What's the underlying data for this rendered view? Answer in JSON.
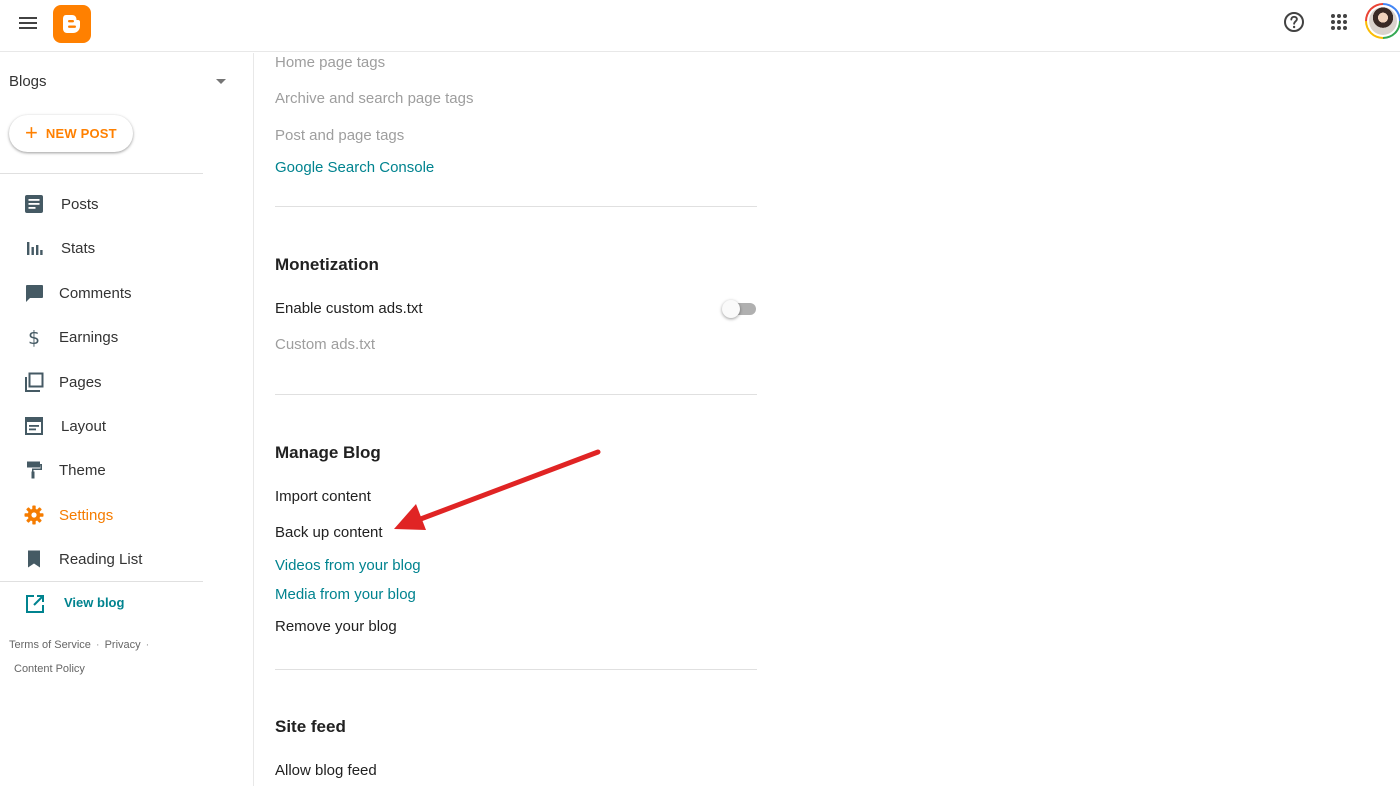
{
  "topbar": {
    "menu_icon": "hamburger-menu-icon",
    "logo_icon": "blogger-logo-icon",
    "help_icon": "help-circle-icon",
    "apps_icon": "apps-grid-icon",
    "avatar_icon": "user-avatar",
    "brand_color": "#ff8000"
  },
  "sidebar": {
    "blogs_label": "Blogs",
    "new_post_label": "NEW POST",
    "items": [
      {
        "label": "Posts",
        "icon": "posts-icon"
      },
      {
        "label": "Stats",
        "icon": "stats-icon"
      },
      {
        "label": "Comments",
        "icon": "comments-icon"
      },
      {
        "label": "Earnings",
        "icon": "dollar-icon"
      },
      {
        "label": "Pages",
        "icon": "pages-icon"
      },
      {
        "label": "Layout",
        "icon": "layout-icon"
      },
      {
        "label": "Theme",
        "icon": "paint-roller-icon"
      },
      {
        "label": "Settings",
        "icon": "gear-icon",
        "active": true
      },
      {
        "label": "Reading List",
        "icon": "bookmark-icon"
      }
    ],
    "view_blog_label": "View blog",
    "footer": {
      "terms": "Terms of Service",
      "privacy": "Privacy",
      "content_policy": "Content Policy"
    },
    "active_color": "#f57c00",
    "link_color": "#00838f"
  },
  "content": {
    "crawlers": {
      "home_page_tags": "Home page tags",
      "archive_search_tags": "Archive and search page tags",
      "post_page_tags": "Post and page tags",
      "search_console": "Google Search Console"
    },
    "monetization": {
      "title": "Monetization",
      "enable_ads_txt": "Enable custom ads.txt",
      "custom_ads_txt": "Custom ads.txt",
      "ads_txt_enabled": false
    },
    "manage_blog": {
      "title": "Manage Blog",
      "import_content": "Import content",
      "back_up_content": "Back up content",
      "videos": "Videos from your blog",
      "media": "Media from your blog",
      "remove": "Remove your blog"
    },
    "site_feed": {
      "title": "Site feed",
      "allow_feed": "Allow blog feed"
    }
  },
  "annotation": {
    "arrow_color": "#e02424"
  }
}
